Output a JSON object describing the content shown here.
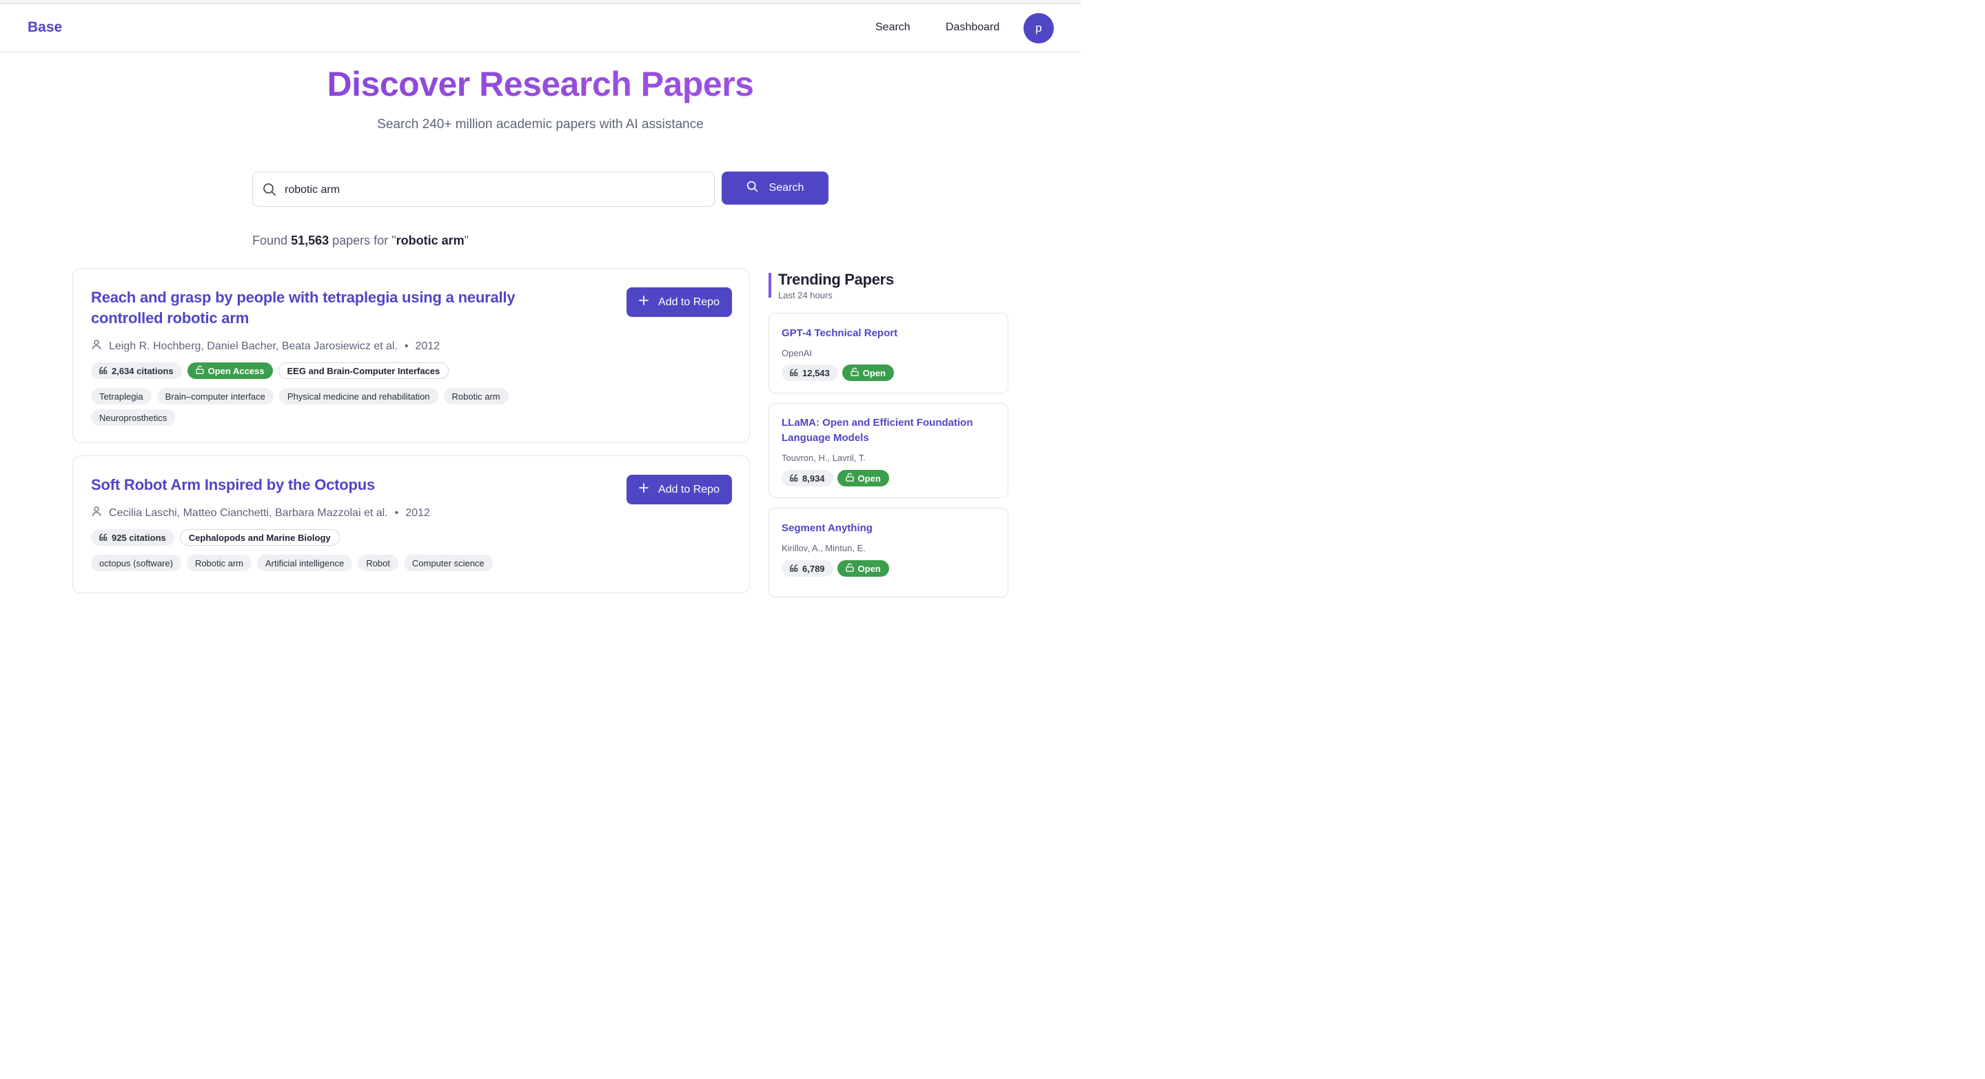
{
  "nav": {
    "brand": "Base",
    "links": [
      "Search",
      "Dashboard"
    ],
    "avatar_initial": "p"
  },
  "hero": {
    "title": "Discover Research Papers",
    "subtitle": "Search 240+ million academic papers with AI assistance"
  },
  "search": {
    "value": "robotic arm",
    "button_label": "Search"
  },
  "results_summary": {
    "prefix": "Found",
    "count": "51,563",
    "middle": "papers for",
    "query_open": "\"",
    "query": "robotic arm",
    "query_close": "\""
  },
  "results": [
    {
      "title": "Reach and grasp by people with tetraplegia using a neurally controlled robotic arm",
      "authors": "Leigh R. Hochberg, Daniel Bacher, Beata Jarosiewicz et al.",
      "year": "2012",
      "citations": "2,634 citations",
      "access": "Open Access",
      "field": "EEG and Brain-Computer Interfaces",
      "tags": [
        "Tetraplegia",
        "Brain–computer interface",
        "Physical medicine and rehabilitation",
        "Robotic arm",
        "Neuroprosthetics"
      ],
      "action_label": "Add to Repo"
    },
    {
      "title": "Soft Robot Arm Inspired by the Octopus",
      "authors": "Cecilia Laschi, Matteo Cianchetti, Barbara Mazzolai et al.",
      "year": "2012",
      "citations": "925 citations",
      "field": "Cephalopods and Marine Biology",
      "tags": [
        "octopus (software)",
        "Robotic arm",
        "Artificial intelligence",
        "Robot",
        "Computer science"
      ],
      "action_label": "Add to Repo"
    }
  ],
  "trending": {
    "title": "Trending Papers",
    "subtitle": "Last 24 hours",
    "papers": [
      {
        "title": "GPT-4 Technical Report",
        "authors": "OpenAI",
        "citations": "12,543",
        "access": "Open"
      },
      {
        "title": "LLaMA: Open and Efficient Foundation Language Models",
        "authors": "Touvron, H., Lavril, T.",
        "citations": "8,934",
        "access": "Open"
      },
      {
        "title": "Segment Anything",
        "authors": "Kirillov, A., Mintun, E.",
        "citations": "6,789",
        "access": "Open"
      }
    ]
  },
  "icons": {
    "search": "search-icon",
    "user": "user-icon",
    "quote": "quote-icon",
    "unlock": "unlock-icon",
    "plus": "plus-icon"
  },
  "colors": {
    "brand": "#4f46c5",
    "open_access": "#3b9e4d",
    "title_gradient": [
      "#7b3fd0",
      "#9b57e2"
    ]
  }
}
